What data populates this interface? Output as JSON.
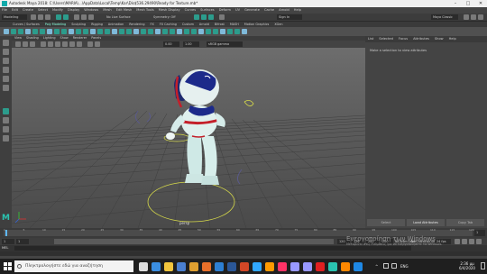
{
  "window": {
    "title": "Autodesk Maya 2018: C:\\Users\\MARIA\\...\\AppData\\Local\\Temp\\Kar\\Dis$536.29490\\Ready for Texture.mb*"
  },
  "menubar": [
    "File",
    "Edit",
    "Create",
    "Select",
    "Modify",
    "Display",
    "Windows",
    "Mesh",
    "Edit Mesh",
    "Mesh Tools",
    "Mesh Display",
    "Curves",
    "Surfaces",
    "Deform",
    "UV",
    "Generate",
    "Cache",
    "Arnold",
    "Help"
  ],
  "statusline": {
    "mode": "Modeling",
    "sign_in": "Sign In",
    "symmetry": "Symmetry: Off",
    "no_live": "No Live Surface",
    "workspace": "Maya Classic"
  },
  "shelf_tabs": [
    "Curves / Surfaces",
    "Poly Modeling",
    "Sculpting",
    "Rigging",
    "Animation",
    "Rendering",
    "FX",
    "FX Caching",
    "Custom",
    "Arnold",
    "Bifrost",
    "MASH",
    "Motion Graphics",
    "XGen"
  ],
  "shelf_active": "Poly Modeling",
  "viewport": {
    "menus": [
      "View",
      "Shading",
      "Lighting",
      "Show",
      "Renderer",
      "Panels"
    ],
    "gamma": "0.00",
    "exposure": "1.00",
    "color_space": "sRGB gamma",
    "camera_label": "persp"
  },
  "panel": {
    "tabs": [
      "List",
      "Selected",
      "Focus",
      "Attributes",
      "Show",
      "Help"
    ],
    "message": "Make a selection to view attributes",
    "buttons": [
      "Select",
      "Load Attributes",
      "Copy Tab"
    ]
  },
  "timeline": {
    "ticks": [
      "1",
      "5",
      "10",
      "15",
      "20",
      "25",
      "30",
      "35",
      "40",
      "45",
      "50",
      "55",
      "60",
      "65",
      "70",
      "75",
      "80",
      "85",
      "90",
      "95",
      "100",
      "105",
      "110",
      "115",
      "120"
    ],
    "current": "1"
  },
  "range": {
    "start": "1",
    "start2": "1",
    "end": "120",
    "end2": "120",
    "end3": "200",
    "end4": "200",
    "anim_layer": "No Anim Layer",
    "char_set": "No Character Set",
    "fps": "24 fps"
  },
  "command": {
    "lang": "MEL"
  },
  "watermark": {
    "line1": "Ενεργοποίηση των Windows",
    "line2": "Μεταβείτε στις Ρυθμίσεις για να ενεργοποιήσετε τα Windows."
  },
  "taskbar": {
    "search_placeholder": "Πληκτρολογήστε εδώ για αναζήτηση",
    "time": "2:36 μμ",
    "date": "6/4/2020",
    "lang": "ENG",
    "apps": [
      {
        "name": "task-view-icon",
        "color": "#dddddd"
      },
      {
        "name": "edge-icon",
        "color": "#3b8ee0"
      },
      {
        "name": "explorer-icon",
        "color": "#f2c53d"
      },
      {
        "name": "store-icon",
        "color": "#4a7fd0"
      },
      {
        "name": "chrome-icon",
        "color": "#e0a030"
      },
      {
        "name": "firefox-icon",
        "color": "#e8702a"
      },
      {
        "name": "mail-icon",
        "color": "#2d7fd3"
      },
      {
        "name": "word-icon",
        "color": "#2b5797"
      },
      {
        "name": "powerpoint-icon",
        "color": "#d24726"
      },
      {
        "name": "photoshop-icon",
        "color": "#31a8ff"
      },
      {
        "name": "illustrator-icon",
        "color": "#ff9a00"
      },
      {
        "name": "indesign-icon",
        "color": "#ff3366"
      },
      {
        "name": "premiere-icon",
        "color": "#9999ff"
      },
      {
        "name": "aftereffects-icon",
        "color": "#9999ff"
      },
      {
        "name": "acrobat-icon",
        "color": "#e02020"
      },
      {
        "name": "maya-icon",
        "color": "#2ac3b0"
      },
      {
        "name": "vlc-icon",
        "color": "#ff8800"
      },
      {
        "name": "photos-icon",
        "color": "#1e88e5"
      }
    ]
  },
  "colors": {
    "accent": "#2ac3b0",
    "selection_ring": "#d6d94a"
  }
}
